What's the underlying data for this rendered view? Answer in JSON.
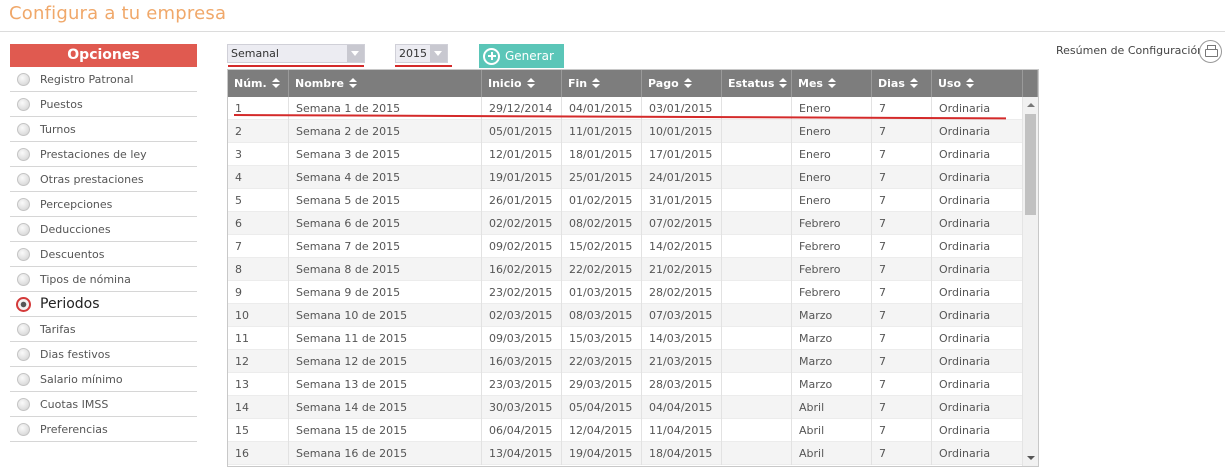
{
  "page": {
    "title": "Configura a tu empresa"
  },
  "sidebar": {
    "header": "Opciones",
    "items": [
      {
        "label": "Registro Patronal",
        "active": false
      },
      {
        "label": "Puestos",
        "active": false
      },
      {
        "label": "Turnos",
        "active": false
      },
      {
        "label": "Prestaciones de ley",
        "active": false
      },
      {
        "label": "Otras prestaciones",
        "active": false
      },
      {
        "label": "Percepciones",
        "active": false
      },
      {
        "label": "Deducciones",
        "active": false
      },
      {
        "label": "Descuentos",
        "active": false
      },
      {
        "label": "Tipos de nómina",
        "active": false
      },
      {
        "label": "Periodos",
        "active": true
      },
      {
        "label": "Tarifas",
        "active": false
      },
      {
        "label": "Dias festivos",
        "active": false
      },
      {
        "label": "Salario mínimo",
        "active": false
      },
      {
        "label": "Cuotas IMSS",
        "active": false
      },
      {
        "label": "Preferencias",
        "active": false
      }
    ]
  },
  "controls": {
    "period_type": "Semanal",
    "year": "2015",
    "generate_label": "Generar"
  },
  "summary": {
    "label": "Resúmen de Configuración"
  },
  "grid": {
    "columns": [
      "Núm.",
      "Nombre",
      "Inicio",
      "Fin",
      "Pago",
      "Estatus",
      "Mes",
      "Dias",
      "Uso"
    ],
    "rows": [
      [
        "1",
        "Semana 1 de 2015",
        "29/12/2014",
        "04/01/2015",
        "03/01/2015",
        "",
        "Enero",
        "7",
        "Ordinaria"
      ],
      [
        "2",
        "Semana 2 de 2015",
        "05/01/2015",
        "11/01/2015",
        "10/01/2015",
        "",
        "Enero",
        "7",
        "Ordinaria"
      ],
      [
        "3",
        "Semana 3 de 2015",
        "12/01/2015",
        "18/01/2015",
        "17/01/2015",
        "",
        "Enero",
        "7",
        "Ordinaria"
      ],
      [
        "4",
        "Semana 4 de 2015",
        "19/01/2015",
        "25/01/2015",
        "24/01/2015",
        "",
        "Enero",
        "7",
        "Ordinaria"
      ],
      [
        "5",
        "Semana 5 de 2015",
        "26/01/2015",
        "01/02/2015",
        "31/01/2015",
        "",
        "Enero",
        "7",
        "Ordinaria"
      ],
      [
        "6",
        "Semana 6 de 2015",
        "02/02/2015",
        "08/02/2015",
        "07/02/2015",
        "",
        "Febrero",
        "7",
        "Ordinaria"
      ],
      [
        "7",
        "Semana 7 de 2015",
        "09/02/2015",
        "15/02/2015",
        "14/02/2015",
        "",
        "Febrero",
        "7",
        "Ordinaria"
      ],
      [
        "8",
        "Semana 8 de 2015",
        "16/02/2015",
        "22/02/2015",
        "21/02/2015",
        "",
        "Febrero",
        "7",
        "Ordinaria"
      ],
      [
        "9",
        "Semana 9 de 2015",
        "23/02/2015",
        "01/03/2015",
        "28/02/2015",
        "",
        "Febrero",
        "7",
        "Ordinaria"
      ],
      [
        "10",
        "Semana 10 de 2015",
        "02/03/2015",
        "08/03/2015",
        "07/03/2015",
        "",
        "Marzo",
        "7",
        "Ordinaria"
      ],
      [
        "11",
        "Semana 11 de 2015",
        "09/03/2015",
        "15/03/2015",
        "14/03/2015",
        "",
        "Marzo",
        "7",
        "Ordinaria"
      ],
      [
        "12",
        "Semana 12 de 2015",
        "16/03/2015",
        "22/03/2015",
        "21/03/2015",
        "",
        "Marzo",
        "7",
        "Ordinaria"
      ],
      [
        "13",
        "Semana 13 de 2015",
        "23/03/2015",
        "29/03/2015",
        "28/03/2015",
        "",
        "Marzo",
        "7",
        "Ordinaria"
      ],
      [
        "14",
        "Semana 14 de 2015",
        "30/03/2015",
        "05/04/2015",
        "04/04/2015",
        "",
        "Abril",
        "7",
        "Ordinaria"
      ],
      [
        "15",
        "Semana 15 de 2015",
        "06/04/2015",
        "12/04/2015",
        "11/04/2015",
        "",
        "Abril",
        "7",
        "Ordinaria"
      ],
      [
        "16",
        "Semana 16 de 2015",
        "13/04/2015",
        "19/04/2015",
        "18/04/2015",
        "",
        "Abril",
        "7",
        "Ordinaria"
      ]
    ]
  }
}
